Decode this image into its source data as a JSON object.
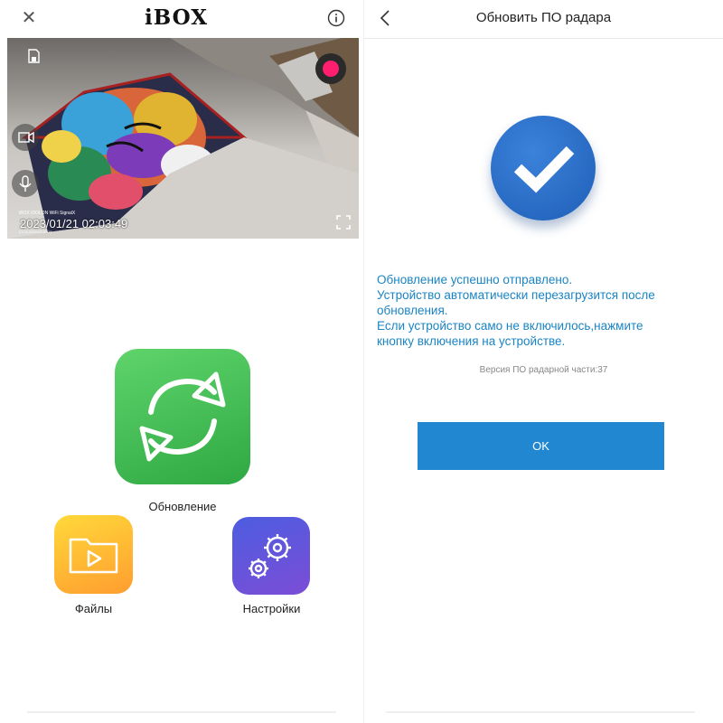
{
  "left": {
    "header": {
      "close_icon": "close-icon",
      "logo": "iBOX",
      "info_icon": "info-icon"
    },
    "camera": {
      "timestamp": "2023/01/21 02:03:49",
      "osd_line1": "iBOX IDOLON WiFi SignalX",
      "osd_line2": "21.01.2023 02:07:21",
      "record_color": "#ff1f6e"
    },
    "apps": {
      "update_label": "Обновление",
      "files_label": "Файлы",
      "settings_label": "Настройки"
    }
  },
  "right": {
    "title": "Обновить ПО радара",
    "message_lines": [
      "Обновление успешно отправлено.",
      "Устройство автоматически перезагрузится после",
      "обновления.",
      "Если устройство само не включилось,нажмите",
      "кнопку включения на устройстве."
    ],
    "version": "Версия ПО радарной части:37",
    "ok_label": "OK",
    "accent_color": "#2287d1",
    "message_color": "#1a84c4"
  }
}
